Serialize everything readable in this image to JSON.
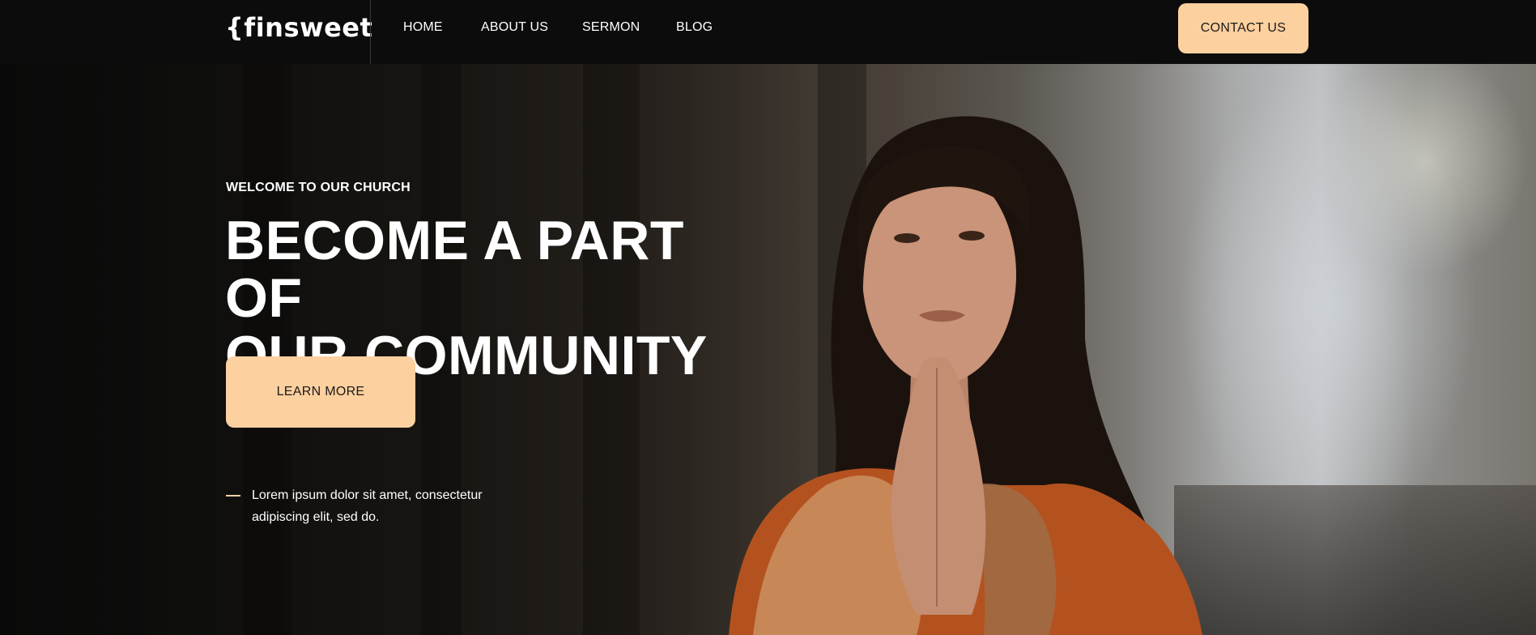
{
  "header": {
    "logo_text": "{finsweet",
    "nav": [
      {
        "label": "HOME"
      },
      {
        "label": "ABOUT US"
      },
      {
        "label": "SERMON"
      },
      {
        "label": "BLOG"
      }
    ],
    "contact_label": "CONTACT US"
  },
  "hero": {
    "eyebrow": "WELCOME TO OUR CHURCH",
    "headline_line1": "BECOME A PART OF",
    "headline_line2": "OUR COMMUNITY",
    "cta_label": "LEARN MORE",
    "quote_line1": "Lorem ipsum dolor sit amet, consectetur",
    "quote_line2": "adipiscing elit, sed do."
  },
  "colors": {
    "accent": "#fcd09f",
    "nav_background": "#0c0c0c",
    "text": "#ffffff"
  }
}
